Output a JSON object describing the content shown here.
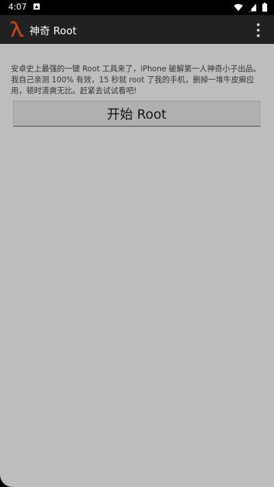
{
  "status_bar": {
    "time": "4:07",
    "icons": [
      "notification-icon",
      "wifi-icon",
      "signal-icon",
      "battery-icon"
    ]
  },
  "app_bar": {
    "logo_icon": "lambda-logo-icon",
    "title": "神奇 Root",
    "menu_icon": "overflow-menu-icon"
  },
  "content": {
    "intro_text": "安卓史上最强的一键 Root 工具来了，iPhone 破解第一人神奇小子出品。我自己亲测 100% 有效，15 秒就 root 了我的手机，删掉一堆牛皮癣应用，顿时清爽无比。赶紧去试试看吧!",
    "start_button_label": "开始 Root"
  },
  "colors": {
    "background": "#bdbdbd",
    "app_bar": "#212121",
    "status_bar": "#000000",
    "logo": "#c1441d",
    "button": "#b0b0b0"
  }
}
